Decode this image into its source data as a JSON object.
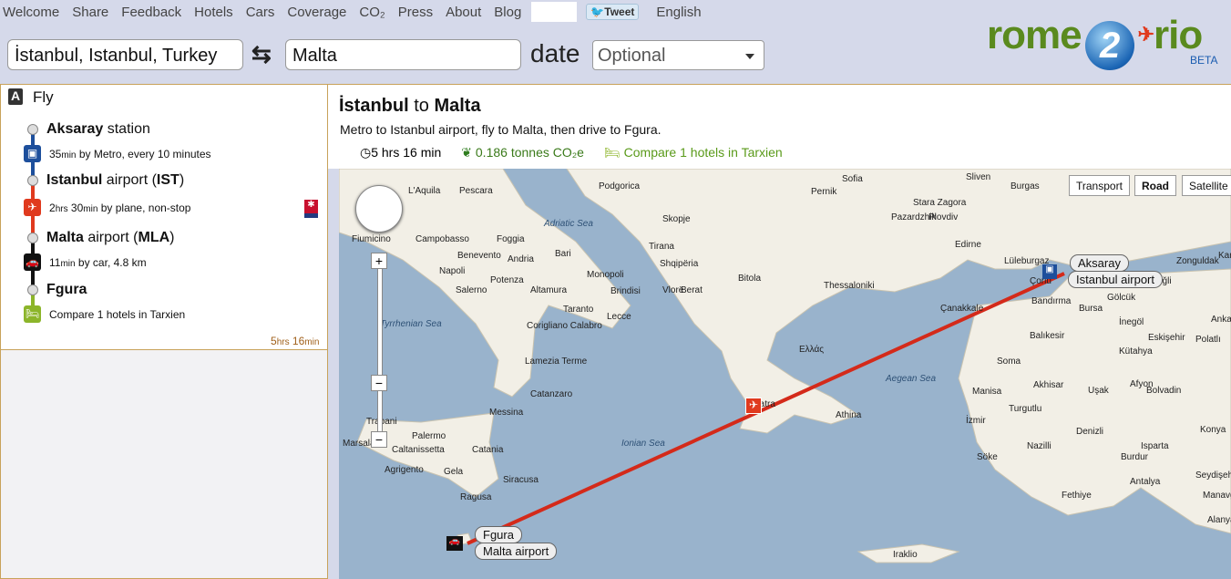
{
  "nav": {
    "items": [
      "Welcome",
      "Share",
      "Feedback",
      "Hotels",
      "Cars",
      "Coverage",
      "CO₂",
      "Press",
      "About",
      "Blog"
    ],
    "tweet": "Tweet",
    "language": "English"
  },
  "search": {
    "from": "İstanbul, Istanbul, Turkey",
    "to": "Malta",
    "date_label": "date",
    "date_value": "Optional"
  },
  "logo": {
    "left": "rome",
    "mid": "2",
    "right": "rio",
    "beta": "BETA"
  },
  "itinerary": {
    "badge": "A",
    "title": "Fly",
    "stops": [
      {
        "bold": "Aksaray",
        "rest": " station"
      },
      {
        "bold": "Istanbul",
        "rest": " airport (",
        "code": "IST",
        "end": ")"
      },
      {
        "bold": "Malta",
        "rest": " airport (",
        "code": "MLA",
        "end": ")"
      },
      {
        "bold": "Fgura",
        "rest": ""
      }
    ],
    "steps": [
      {
        "n1": "35",
        "u1": "min",
        "text": " by Metro, every 10 minutes",
        "color": "#1d4f9c"
      },
      {
        "n0": "2",
        "u0": "hrs",
        "n1": " 30",
        "u1": "min",
        "text": " by plane, non-stop",
        "color": "#e03a1e"
      },
      {
        "n1": "11",
        "u1": "min",
        "text": " by car, 4.8 km",
        "color": "#111111"
      },
      {
        "text": "Compare 1 hotels in Tarxien",
        "color": "#8cb52a"
      }
    ],
    "total": {
      "h": "5",
      "hu": "hrs",
      "m": " 16",
      "mu": "min"
    }
  },
  "route": {
    "from": "İstanbul",
    "mid": " to ",
    "to": "Malta",
    "description": "Metro to Istanbul airport, fly to Malta, then drive to Fgura.",
    "duration": "5 hrs 16 min",
    "co2": "0.186 tonnes CO₂e",
    "hotels": "Compare 1 hotels in Tarxien"
  },
  "map": {
    "types": [
      "Transport",
      "Road",
      "Satellite"
    ],
    "active_type": "Road",
    "pins": [
      "Aksaray",
      "Istanbul airport",
      "Fgura",
      "Malta airport"
    ],
    "seas": [
      "Adriatic Sea",
      "Tyrrhenian Sea",
      "Ionian Sea",
      "Aegean Sea"
    ],
    "cities": [
      [
        "L'Aquila",
        76,
        19
      ],
      [
        "Pescara",
        132,
        19
      ],
      [
        "Fiumicino",
        14,
        72
      ],
      [
        "Campobasso",
        84,
        72
      ],
      [
        "Foggia",
        173,
        72
      ],
      [
        "Napoli",
        110,
        107
      ],
      [
        "Benevento",
        130,
        90
      ],
      [
        "Andria",
        185,
        94
      ],
      [
        "Bari",
        237,
        88
      ],
      [
        "Salerno",
        128,
        128
      ],
      [
        "Altamura",
        210,
        128
      ],
      [
        "Monopoli",
        272,
        111
      ],
      [
        "Brindisi",
        298,
        129
      ],
      [
        "Potenza",
        166,
        117
      ],
      [
        "Taranto",
        246,
        149
      ],
      [
        "Lecce",
        294,
        157
      ],
      [
        "Corigliano Calabro",
        206,
        167
      ],
      [
        "Lamezia Terme",
        204,
        206
      ],
      [
        "Catanzaro",
        210,
        242
      ],
      [
        "Messina",
        165,
        262
      ],
      [
        "Trapani",
        30,
        272
      ],
      [
        "Palermo",
        80,
        288
      ],
      [
        "Marsala",
        4,
        296
      ],
      [
        "Caltanissetta",
        58,
        303
      ],
      [
        "Catania",
        146,
        303
      ],
      [
        "Agrigento",
        50,
        325
      ],
      [
        "Gela",
        115,
        327
      ],
      [
        "Siracusa",
        180,
        336
      ],
      [
        "Ragusa",
        133,
        355
      ],
      [
        "Podgorica",
        285,
        14
      ],
      [
        "Skopje",
        355,
        50
      ],
      [
        "Shqipëria",
        352,
        99
      ],
      [
        "Tirana",
        340,
        80
      ],
      [
        "Bitola",
        438,
        115
      ],
      [
        "Berat",
        375,
        128
      ],
      [
        "Vlorë",
        355,
        128
      ],
      [
        "Thessaloniki",
        532,
        123
      ],
      [
        "Ελλάς",
        505,
        193
      ],
      [
        "Patra",
        455,
        253
      ],
      [
        "Athina",
        545,
        265
      ],
      [
        "Sofia",
        552,
        6
      ],
      [
        "Pernik",
        518,
        20
      ],
      [
        "Pazardzhik",
        606,
        48
      ],
      [
        "Plovdiv",
        647,
        48
      ],
      [
        "Stara Zagora",
        630,
        32
      ],
      [
        "Sliven",
        688,
        4
      ],
      [
        "Burgas",
        737,
        14
      ],
      [
        "Edirne",
        676,
        78
      ],
      [
        "Lüleburgaz",
        730,
        96
      ],
      [
        "Çorlu",
        758,
        118
      ],
      [
        "Çanakkale",
        660,
        148
      ],
      [
        "Bandırma",
        760,
        140
      ],
      [
        "Bursa",
        812,
        148
      ],
      [
        "Gölcük",
        843,
        136
      ],
      [
        "İnegöl",
        856,
        163
      ],
      [
        "Balıkesir",
        758,
        178
      ],
      [
        "Eskişehir",
        888,
        180
      ],
      [
        "Kütahya",
        856,
        195
      ],
      [
        "Polatlı",
        940,
        182
      ],
      [
        "Soma",
        722,
        206
      ],
      [
        "Akhisar",
        762,
        232
      ],
      [
        "Manisa",
        695,
        239
      ],
      [
        "Uşak",
        822,
        238
      ],
      [
        "İzmir",
        688,
        271
      ],
      [
        "Turgutlu",
        735,
        258
      ],
      [
        "Nazilli",
        755,
        299
      ],
      [
        "Denizli",
        809,
        283
      ],
      [
        "Afyon",
        868,
        231
      ],
      [
        "Bolvadin",
        886,
        238
      ],
      [
        "Isparta",
        880,
        299
      ],
      [
        "Konya",
        945,
        281
      ],
      [
        "Burdur",
        858,
        311
      ],
      [
        "Söke",
        700,
        311
      ],
      [
        "Fethiye",
        793,
        353
      ],
      [
        "Antalya",
        868,
        338
      ],
      [
        "Manavgat",
        948,
        353
      ],
      [
        "Alanya",
        953,
        380
      ],
      [
        "Seydişehir",
        940,
        331
      ],
      [
        "Iraklio",
        608,
        418
      ],
      [
        "Zonguldak",
        919,
        96
      ],
      [
        "Ereğli",
        888,
        118
      ],
      [
        "Karabük",
        965,
        90
      ],
      [
        "Ankara",
        957,
        160
      ]
    ]
  }
}
